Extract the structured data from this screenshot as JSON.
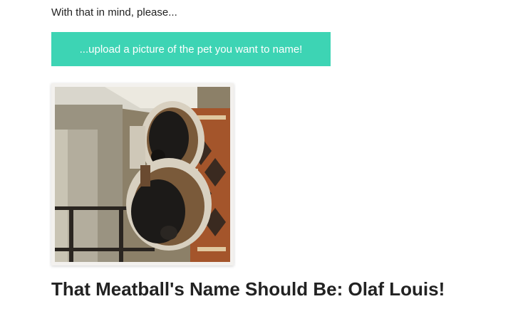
{
  "intro": {
    "text": "With that in mind, please..."
  },
  "upload": {
    "label": "...upload a picture of the pet you want to name!",
    "color": "#3dd4b4"
  },
  "photo": {
    "subject": "pet-photo"
  },
  "result": {
    "heading": "That Meatball's Name Should Be: Olaf Louis!"
  }
}
